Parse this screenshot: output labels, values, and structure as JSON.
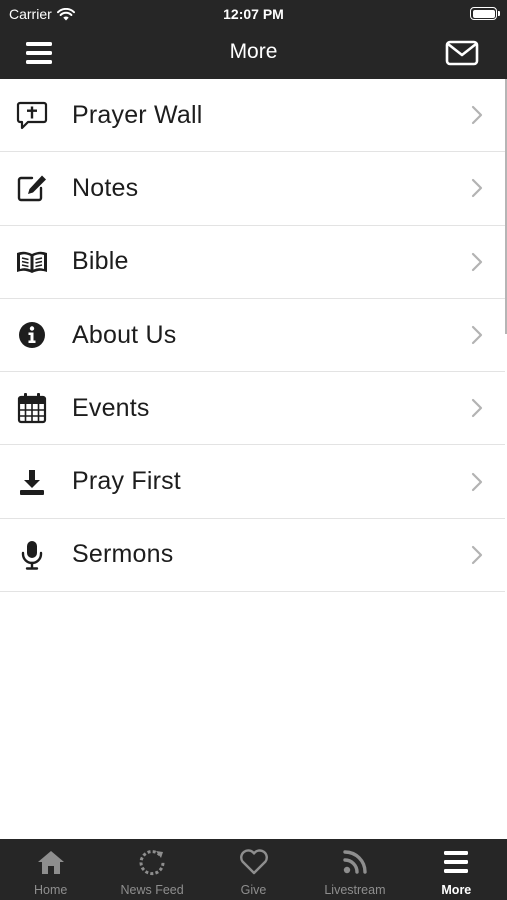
{
  "status_bar": {
    "carrier": "Carrier",
    "time": "12:07 PM"
  },
  "nav": {
    "title": "More",
    "left_icon": "hamburger-menu-icon",
    "right_icon": "envelope-icon"
  },
  "menu_items": [
    {
      "label": "Prayer Wall",
      "icon": "prayer-chat-cross-icon"
    },
    {
      "label": "Notes",
      "icon": "pencil-square-icon"
    },
    {
      "label": "Bible",
      "icon": "open-book-icon"
    },
    {
      "label": "About Us",
      "icon": "info-circle-icon"
    },
    {
      "label": "Events",
      "icon": "calendar-icon"
    },
    {
      "label": "Pray First",
      "icon": "download-icon"
    },
    {
      "label": "Sermons",
      "icon": "microphone-icon"
    }
  ],
  "tabs": [
    {
      "label": "Home",
      "icon": "home-icon",
      "active": false
    },
    {
      "label": "News Feed",
      "icon": "refresh-icon",
      "active": false
    },
    {
      "label": "Give",
      "icon": "heart-icon",
      "active": false
    },
    {
      "label": "Livestream",
      "icon": "rss-icon",
      "active": false
    },
    {
      "label": "More",
      "icon": "hamburger-menu-icon",
      "active": true
    }
  ],
  "colors": {
    "bar_background": "#262626",
    "text": "#1d1d1d",
    "inactive_tab": "#8e8e8e",
    "active_tab": "#ffffff",
    "divider": "#e3e3e3",
    "chevron": "#b3b3b3"
  }
}
